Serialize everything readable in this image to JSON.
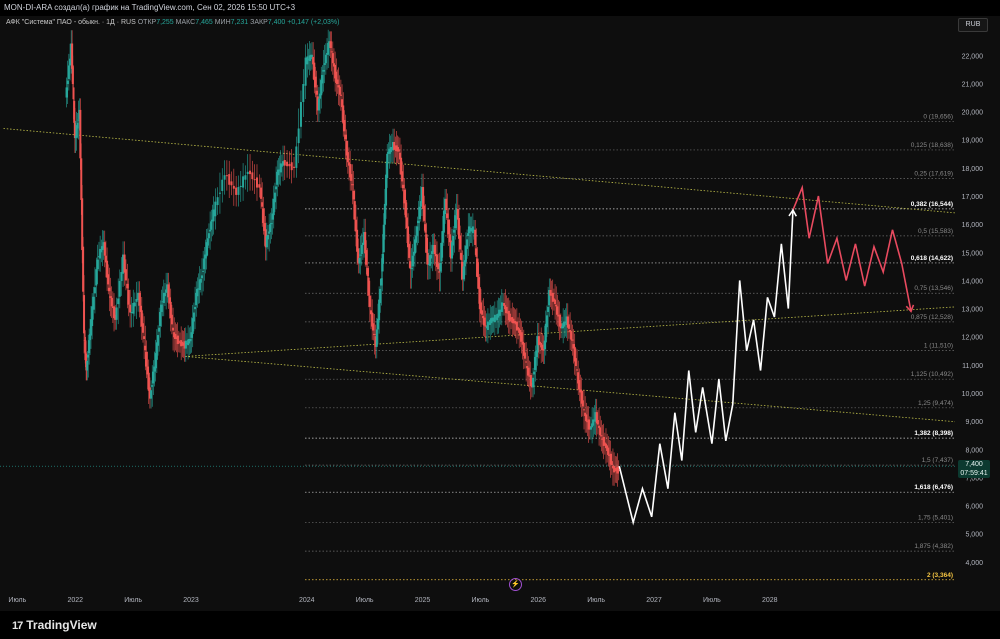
{
  "header": {
    "caption": "MON-DI-ARA создал(а) график на TradingView.com, Сен 02, 2026 15:50 UTC+3"
  },
  "legend": {
    "symbol": "АФК \"Система\" ПАО - обыкн. · 1Д · RUS",
    "open_label": "ОТКР",
    "open_value": "7,255",
    "high_label": "МАКС",
    "high_value": "7,465",
    "low_label": "МИН",
    "low_value": "7,231",
    "close_label": "ЗАКР",
    "close_value": "7,400",
    "change": "+0,147 (+2,03%)"
  },
  "currency": "RUB",
  "last_price": {
    "value": "7,400",
    "countdown": "07:59:41"
  },
  "branding": "TradingView",
  "colors": {
    "up": "#26a69a",
    "down": "#ef5350",
    "projection_up": "#ffffff",
    "projection_down": "#e84a5f",
    "trendline": "#bfbf4a",
    "fib_highlight": "#f5c542"
  },
  "chart_data": {
    "type": "line",
    "y_ticks": [
      "22,000",
      "21,000",
      "20,000",
      "19,000",
      "18,000",
      "17,000",
      "16,000",
      "15,000",
      "14,000",
      "13,000",
      "12,000",
      "11,000",
      "10,000",
      "9,000",
      "8,000",
      "7,000",
      "6,000",
      "5,000",
      "4,000"
    ],
    "x_ticks": [
      {
        "label": "Июль",
        "t": 2021.5
      },
      {
        "label": "2022",
        "t": 2022.0
      },
      {
        "label": "Июль",
        "t": 2022.5
      },
      {
        "label": "2023",
        "t": 2023.0
      },
      {
        "label": "2024",
        "t": 2024.0
      },
      {
        "label": "Июль",
        "t": 2024.5
      },
      {
        "label": "2025",
        "t": 2025.0
      },
      {
        "label": "Июль",
        "t": 2025.5
      },
      {
        "label": "2026",
        "t": 2026.0
      },
      {
        "label": "Июль",
        "t": 2026.5
      },
      {
        "label": "2027",
        "t": 2027.0
      },
      {
        "label": "Июль",
        "t": 2027.5
      },
      {
        "label": "2028",
        "t": 2028.0
      }
    ],
    "ylim": [
      3.0,
      22.9
    ],
    "xlim": [
      2021.35,
      2029.6
    ],
    "fib_levels": [
      {
        "label": "0 (19,656)",
        "value": 19.656,
        "bold": false
      },
      {
        "label": "0,125 (18,638)",
        "value": 18.638,
        "bold": false
      },
      {
        "label": "0,25 (17,619)",
        "value": 17.619,
        "bold": false
      },
      {
        "label": "0,382 (16,544)",
        "value": 16.544,
        "bold": true
      },
      {
        "label": "0,5 (15,583)",
        "value": 15.583,
        "bold": false
      },
      {
        "label": "0,618 (14,622)",
        "value": 14.622,
        "bold": true
      },
      {
        "label": "0,75 (13,546)",
        "value": 13.546,
        "bold": false
      },
      {
        "label": "0,875 (12,528)",
        "value": 12.528,
        "bold": false
      },
      {
        "label": "1 (11,510)",
        "value": 11.51,
        "bold": false
      },
      {
        "label": "1,125 (10,492)",
        "value": 10.492,
        "bold": false
      },
      {
        "label": "1,25 (9,474)",
        "value": 9.474,
        "bold": false
      },
      {
        "label": "1,382 (8,398)",
        "value": 8.398,
        "bold": true
      },
      {
        "label": "1,5 (7,437)",
        "value": 7.437,
        "bold": false
      },
      {
        "label": "1,618 (6,476)",
        "value": 6.476,
        "bold": true
      },
      {
        "label": "1,75 (5,401)",
        "value": 5.401,
        "bold": false
      },
      {
        "label": "1,875 (4,382)",
        "value": 4.382,
        "bold": false
      },
      {
        "label": "2 (3,364)",
        "value": 3.364,
        "bold": true,
        "highlight": true
      }
    ],
    "trendlines": [
      {
        "x": [
          2021.38,
          2029.6
        ],
        "y": [
          19.4,
          16.4
        ]
      },
      {
        "x": [
          2022.95,
          2029.6
        ],
        "y": [
          11.3,
          8.98
        ]
      },
      {
        "x": [
          2022.95,
          2029.6
        ],
        "y": [
          11.3,
          13.06
        ]
      }
    ],
    "price_history": {
      "x": [
        2021.92,
        2021.97,
        2022.0,
        2022.04,
        2022.08,
        2022.1,
        2022.14,
        2022.2,
        2022.25,
        2022.3,
        2022.35,
        2022.42,
        2022.48,
        2022.55,
        2022.6,
        2022.65,
        2022.7,
        2022.75,
        2022.8,
        2022.85,
        2022.9,
        2022.95,
        2023.0,
        2023.05,
        2023.1,
        2023.15,
        2023.2,
        2023.3,
        2023.4,
        2023.5,
        2023.6,
        2023.65,
        2023.7,
        2023.75,
        2023.8,
        2023.9,
        2024.0,
        2024.05,
        2024.1,
        2024.15,
        2024.2,
        2024.25,
        2024.3,
        2024.35,
        2024.4,
        2024.45,
        2024.5,
        2024.55,
        2024.6,
        2024.65,
        2024.7,
        2024.75,
        2024.8,
        2024.85,
        2024.9,
        2024.95,
        2025.0,
        2025.05,
        2025.1,
        2025.15,
        2025.2,
        2025.25,
        2025.3,
        2025.35,
        2025.4,
        2025.45,
        2025.5,
        2025.55,
        2025.6,
        2025.65,
        2025.7,
        2025.75,
        2025.8,
        2025.85,
        2025.9,
        2025.95,
        2026.0,
        2026.05,
        2026.1,
        2026.15,
        2026.2,
        2026.25,
        2026.3,
        2026.35,
        2026.4,
        2026.45,
        2026.5,
        2026.55,
        2026.6,
        2026.65,
        2026.7
      ],
      "y": [
        20.5,
        22.3,
        19.0,
        20.0,
        12.0,
        10.8,
        12.5,
        14.8,
        15.3,
        13.5,
        12.6,
        14.8,
        12.8,
        13.5,
        11.8,
        9.8,
        11.3,
        13.2,
        13.8,
        12.1,
        11.8,
        11.7,
        11.9,
        13.5,
        14.2,
        15.5,
        16.4,
        17.8,
        17.1,
        17.9,
        17.3,
        15.3,
        16.1,
        17.8,
        18.2,
        18.0,
        21.8,
        22.0,
        20.1,
        21.6,
        22.5,
        21.3,
        20.5,
        18.5,
        17.3,
        14.6,
        15.6,
        13.0,
        11.7,
        14.2,
        18.5,
        18.8,
        18.6,
        16.8,
        14.3,
        15.6,
        17.2,
        14.5,
        15.2,
        14.2,
        16.9,
        14.9,
        16.6,
        14.1,
        15.8,
        15.8,
        13.1,
        12.3,
        12.6,
        12.7,
        13.2,
        12.7,
        12.5,
        12.1,
        11.0,
        10.2,
        11.9,
        11.5,
        13.6,
        13.2,
        12.3,
        12.6,
        11.8,
        10.4,
        9.3,
        8.7,
        9.2,
        8.4,
        8.0,
        7.3,
        7.25
      ]
    },
    "projection_up": {
      "x": [
        2026.7,
        2026.82,
        2026.9,
        2026.98,
        2027.05,
        2027.12,
        2027.18,
        2027.24,
        2027.3,
        2027.36,
        2027.42,
        2027.5,
        2027.56,
        2027.62,
        2027.68,
        2027.74,
        2027.8,
        2027.86,
        2027.92,
        2027.98,
        2028.04,
        2028.1,
        2028.16,
        2028.2
      ],
      "y": [
        7.4,
        5.4,
        6.6,
        5.6,
        8.2,
        6.6,
        9.3,
        7.6,
        10.8,
        8.6,
        10.2,
        8.2,
        10.5,
        8.3,
        9.6,
        14.0,
        11.5,
        12.6,
        10.8,
        13.4,
        12.7,
        15.3,
        13.0,
        16.5
      ]
    },
    "projection_down": {
      "x": [
        2028.2,
        2028.28,
        2028.34,
        2028.42,
        2028.5,
        2028.58,
        2028.66,
        2028.74,
        2028.82,
        2028.9,
        2028.98,
        2029.06,
        2029.14,
        2029.22
      ],
      "y": [
        16.5,
        17.3,
        15.5,
        17.0,
        14.6,
        15.5,
        14.0,
        15.3,
        13.8,
        15.2,
        14.3,
        15.8,
        14.6,
        12.9
      ]
    }
  }
}
